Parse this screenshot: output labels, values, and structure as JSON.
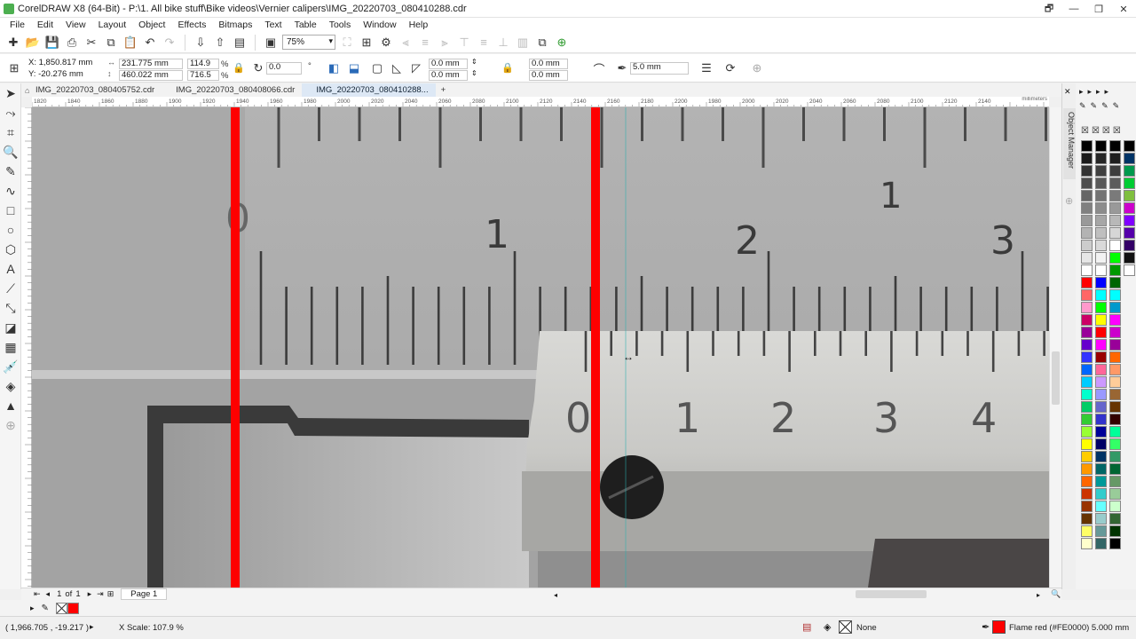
{
  "app": {
    "title": "CorelDRAW X8 (64-Bit) - P:\\1. All bike stuff\\Bike videos\\Vernier calipers\\IMG_20220703_080410288.cdr",
    "window_controls": {
      "restore": "🗗",
      "minimize": "—",
      "maximize": "❐",
      "close": "✕"
    }
  },
  "menu": [
    "File",
    "Edit",
    "View",
    "Layout",
    "Object",
    "Effects",
    "Bitmaps",
    "Text",
    "Table",
    "Tools",
    "Window",
    "Help"
  ],
  "toolbar": {
    "zoom_value": "75%"
  },
  "properties": {
    "x": "X: 1,850.817 mm",
    "y": "Y: -20.276 mm",
    "width": "231.775 mm",
    "height": "460.022 mm",
    "scale_x": "114.9",
    "scale_y": "716.5",
    "pct": "%",
    "rotation": "0.0",
    "deg": "°",
    "corner1": "0.0 mm",
    "corner2": "0.0 mm",
    "corner3": "0.0 mm",
    "corner4": "0.0 mm",
    "outline_width": "5.0 mm"
  },
  "tabs": [
    {
      "label": "IMG_20220703_080405752.cdr",
      "active": false
    },
    {
      "label": "IMG_20220703_080408066.cdr",
      "active": false
    },
    {
      "label": "IMG_20220703_080410288...",
      "active": true
    }
  ],
  "ruler": {
    "labels": [
      "1820",
      "1840",
      "1860",
      "1880",
      "1900",
      "1920",
      "1940",
      "1960",
      "1980",
      "2000",
      "2020",
      "2040",
      "2060",
      "2080",
      "2100",
      "2120",
      "2140",
      "2160",
      "2180",
      "2200",
      "1980",
      "2000",
      "2020",
      "2040",
      "2060",
      "2080",
      "2100",
      "2120",
      "2140"
    ],
    "units": "millimeters"
  },
  "canvas": {
    "main_scale_numbers": [
      "0",
      "1",
      "2",
      "3"
    ],
    "upper_scale_number": "1",
    "vernier_numbers": [
      "0",
      "1",
      "2",
      "3",
      "4"
    ],
    "guide_color": "#FE0000"
  },
  "docker": {
    "label": "Object Manager"
  },
  "pagebar": {
    "page_current": "1",
    "of_label": "of",
    "page_total": "1",
    "page_tab": "Page 1"
  },
  "status": {
    "coords": "( 1,966.705 , -19.217 )",
    "info": "X Scale: 107.9 %",
    "fill_label": "None",
    "outline_label": "Flame red (#FE0000)  5.000 mm",
    "outline_color": "#FE0000"
  }
}
